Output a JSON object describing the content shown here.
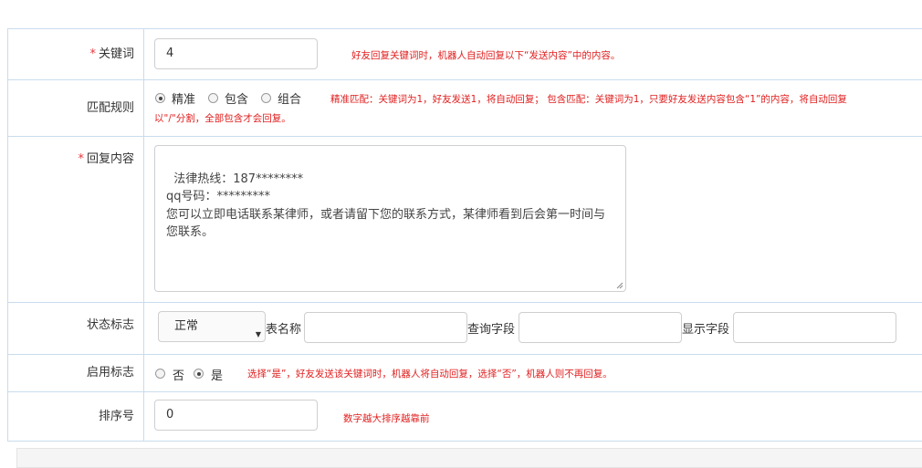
{
  "keyword": {
    "label": "关键词",
    "required_mark": "*",
    "value": "4",
    "hint": "好友回复关键词时，机器人自动回复以下“发送内容”中的内容。"
  },
  "match_rule": {
    "label": "匹配规则",
    "options": [
      "精准",
      "包含",
      "组合"
    ],
    "selected": "精准",
    "hint_line1": "精准匹配：关键词为1，好友发送1，将自动回复； 包含匹配：关键词为1，只要好友发送内容包含“1”的内容，将自动回复",
    "hint_line2": "以\"/\"分割，全部包含才会回复。"
  },
  "reply_content": {
    "label": "回复内容",
    "required_mark": "*",
    "value": "法律热线：187********\nqq号码：*********\n您可以立即电话联系某律师，或者请留下您的联系方式，某律师看到后会第一时间与您联系。"
  },
  "status": {
    "label": "状态标志",
    "select_value": "正常",
    "table_name_label": "表名称",
    "query_field_label": "查询字段",
    "display_field_label": "显示字段"
  },
  "enable": {
    "label": "启用标志",
    "options": [
      "否",
      "是"
    ],
    "selected": "是",
    "hint": "选择“是”，好友发送该关键词时，机器人将自动回复，选择“否”，机器人则不再回复。"
  },
  "sort": {
    "label": "排序号",
    "value": "0",
    "hint": "数字越大排序越靠前"
  }
}
